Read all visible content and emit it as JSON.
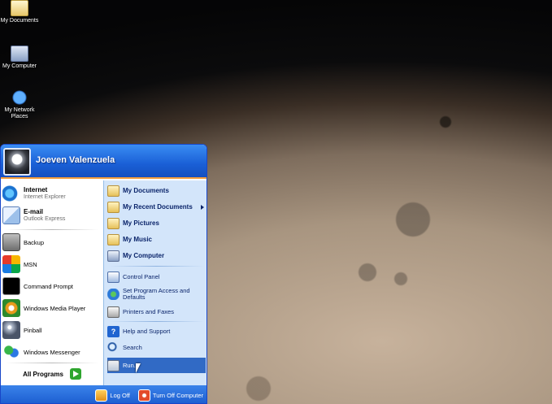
{
  "desktop": {
    "icons": [
      {
        "label": "My Documents"
      },
      {
        "label": "My Computer"
      },
      {
        "label": "My Network Places"
      }
    ]
  },
  "start_menu": {
    "user_name": "Joeven Valenzuela",
    "pinned": [
      {
        "title": "Internet",
        "subtitle": "Internet Explorer"
      },
      {
        "title": "E-mail",
        "subtitle": "Outlook Express"
      }
    ],
    "recent": [
      {
        "label": "Backup"
      },
      {
        "label": "MSN"
      },
      {
        "label": "Command Prompt"
      },
      {
        "label": "Windows Media Player"
      },
      {
        "label": "Pinball"
      },
      {
        "label": "Windows Messenger"
      }
    ],
    "all_programs": "All Programs",
    "right_items": [
      {
        "label": "My Documents"
      },
      {
        "label": "My Recent Documents"
      },
      {
        "label": "My Pictures"
      },
      {
        "label": "My Music"
      },
      {
        "label": "My Computer"
      },
      {
        "label": "Control Panel"
      },
      {
        "label": "Set Program Access and Defaults"
      },
      {
        "label": "Printers and Faxes"
      },
      {
        "label": "Help and Support"
      },
      {
        "label": "Search"
      },
      {
        "label": "Run..."
      }
    ],
    "footer": {
      "log_off": "Log Off",
      "turn_off": "Turn Off Computer"
    }
  }
}
